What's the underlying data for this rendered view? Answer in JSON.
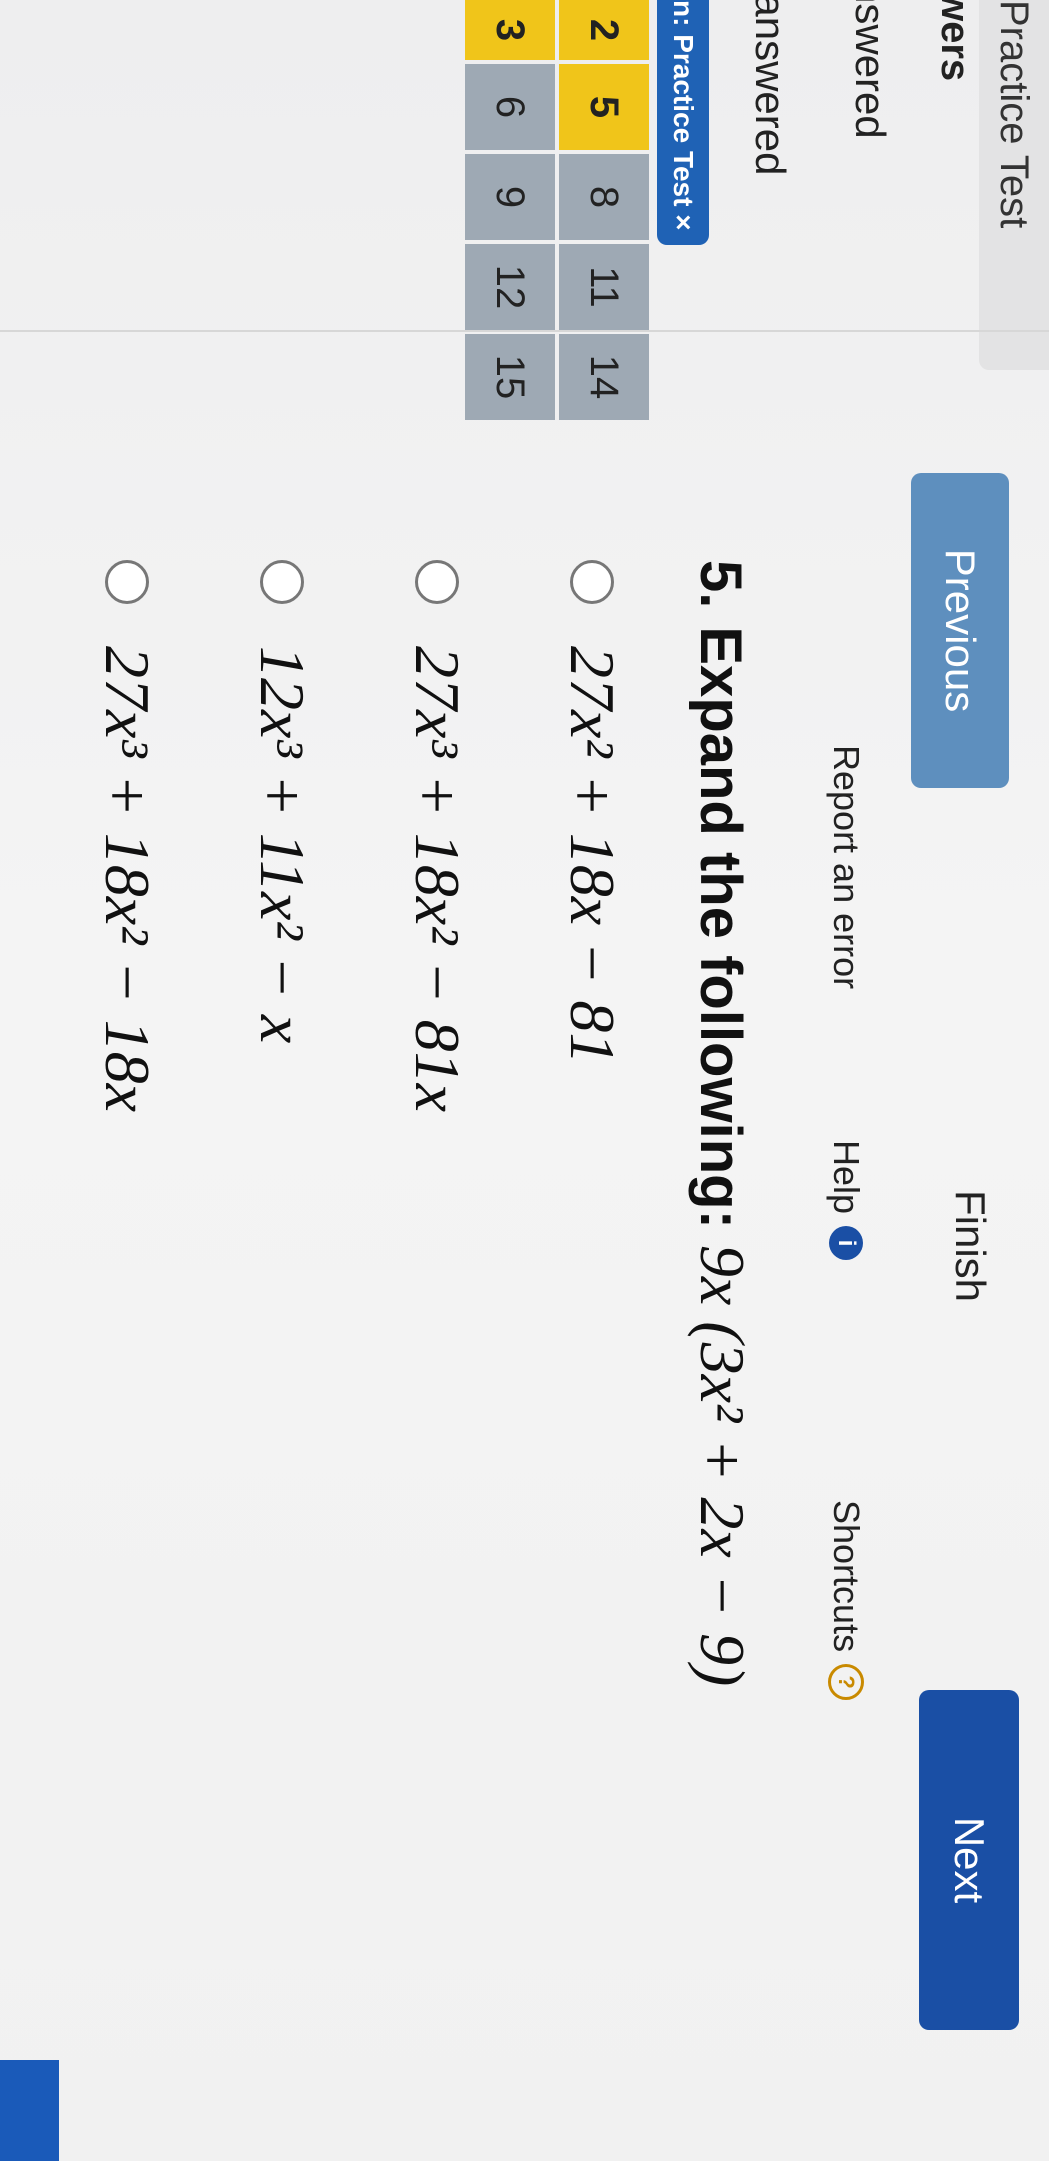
{
  "sidebar": {
    "tab_label": "Practice Test",
    "answers_heading": "wers",
    "answered_label": "nswered",
    "unanswered_label": "nanswered",
    "chip_label": "n: Practice Test ×",
    "grid": [
      [
        "2",
        "5",
        "8",
        "11",
        "14"
      ],
      [
        "3",
        "6",
        "9",
        "12",
        "15"
      ]
    ],
    "current_question": "5"
  },
  "nav": {
    "previous_label": "Previous",
    "finish_label": "Finish",
    "next_label": "Next"
  },
  "links": {
    "report_label": "Report an error",
    "help_label": "Help",
    "shortcuts_label": "Shortcuts"
  },
  "question": {
    "number": "5.",
    "stem": "Expand the following:",
    "expression": "9x (3x² + 2x − 9)"
  },
  "choices": [
    {
      "text": "27x² + 18x − 81"
    },
    {
      "text": "27x³ + 18x² − 81x"
    },
    {
      "text": "12x³ + 11x² − x"
    },
    {
      "text": "27x³ + 18x² − 18x"
    }
  ],
  "colors": {
    "primary": "#1a4fa5",
    "previous_button": "#5e8fbe",
    "current_highlight": "#f0c51a",
    "grid_cell": "#9ea9b4"
  }
}
